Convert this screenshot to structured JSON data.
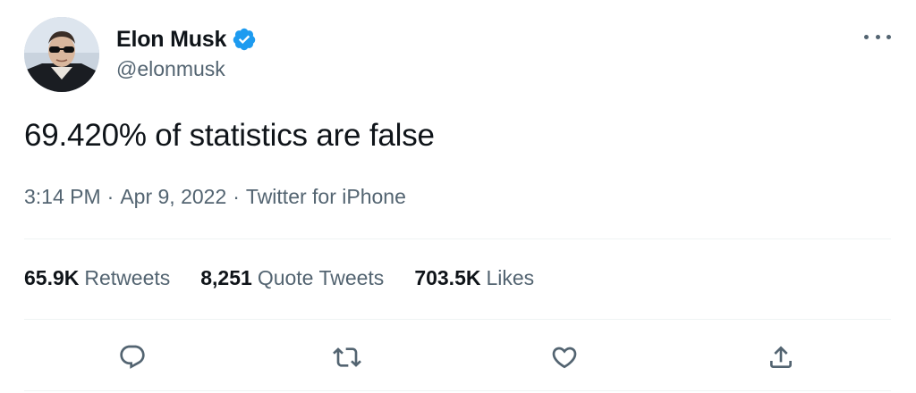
{
  "author": {
    "display_name": "Elon Musk",
    "handle": "@elonmusk",
    "verified": true,
    "avatar_icon": "profile-avatar"
  },
  "tweet": {
    "text": "69.420% of statistics are false",
    "time": "3:14 PM",
    "date": "Apr 9, 2022",
    "separator": "·",
    "source": "Twitter for iPhone"
  },
  "stats": {
    "retweets_count": "65.9K",
    "retweets_label": "Retweets",
    "quote_count": "8,251",
    "quote_label": "Quote Tweets",
    "likes_count": "703.5K",
    "likes_label": "Likes"
  },
  "actions": {
    "reply_icon": "reply-icon",
    "retweet_icon": "retweet-icon",
    "like_icon": "heart-icon",
    "share_icon": "share-icon",
    "more_icon": "more-icon"
  },
  "colors": {
    "primary_text": "#0f1419",
    "secondary_text": "#536471",
    "verified_blue": "#1d9bf0",
    "divider": "#eff3f4"
  }
}
